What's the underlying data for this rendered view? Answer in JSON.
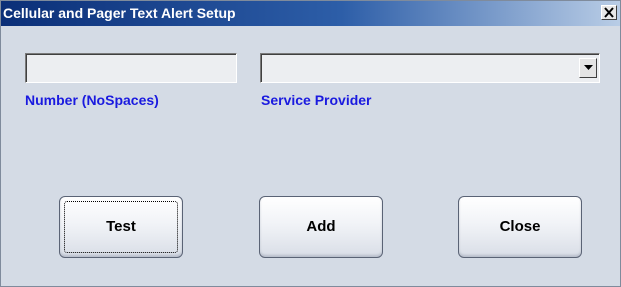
{
  "window": {
    "title": "Cellular and Pager Text Alert Setup",
    "close_glyph": "✕"
  },
  "fields": {
    "number": {
      "value": "",
      "placeholder": "",
      "label": "Number (NoSpaces)"
    },
    "provider": {
      "selected": "",
      "label": "Service Provider"
    }
  },
  "buttons": {
    "test": "Test",
    "add": "Add",
    "close": "Close"
  },
  "colors": {
    "label_blue": "#1a1adf",
    "title_gradient_start": "#0b2f78",
    "title_gradient_end": "#b9cde6",
    "dialog_background": "#d4dbe5"
  },
  "icons": {
    "close": "close-icon",
    "dropdown": "chevron-down-icon"
  }
}
